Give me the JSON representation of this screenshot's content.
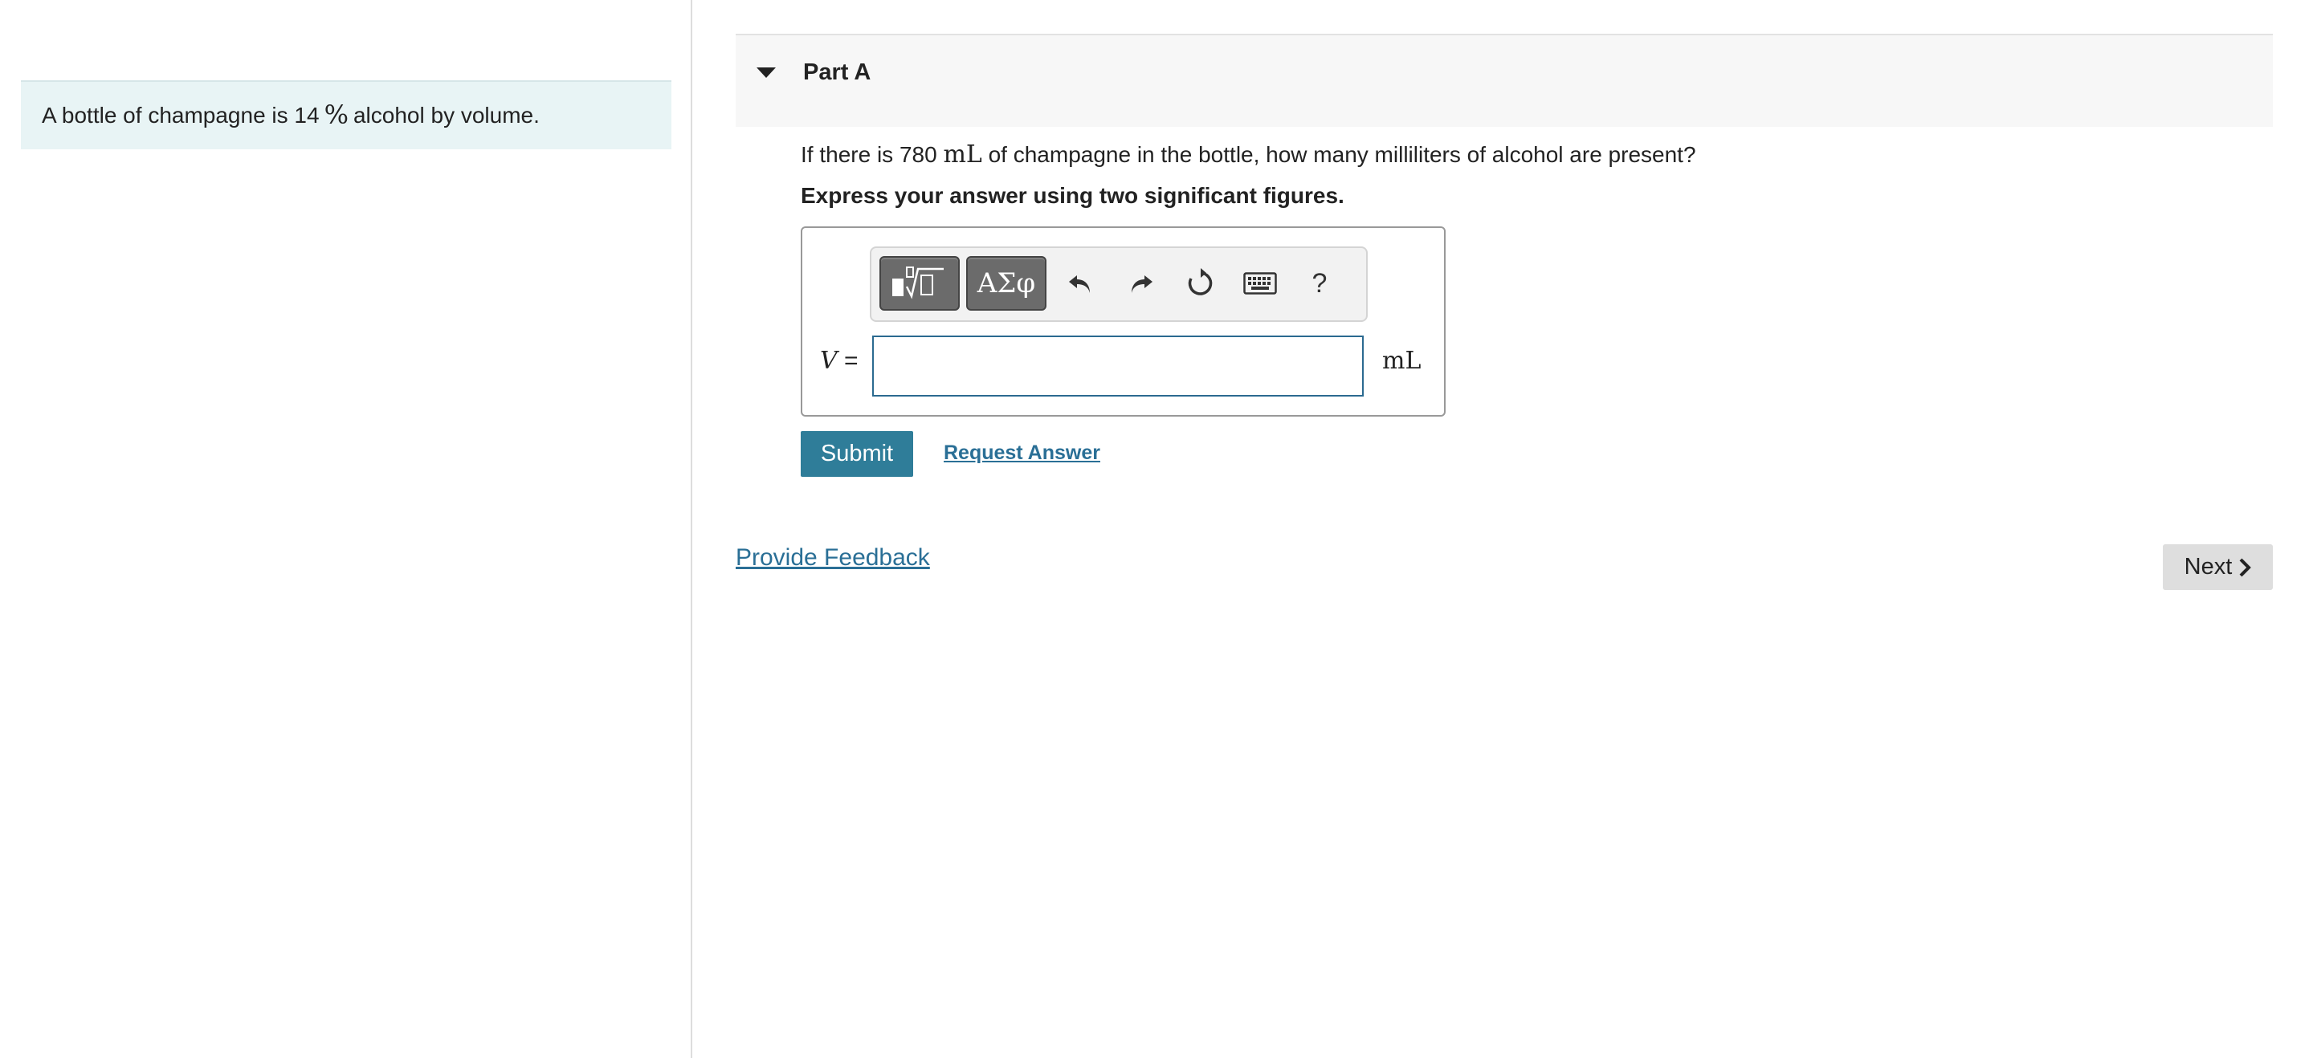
{
  "problem": {
    "text_before": "A bottle of champagne is 14",
    "percent_symbol": "%",
    "text_after": "alcohol by volume."
  },
  "part": {
    "title": "Part A",
    "question_before": "If there is 780",
    "question_unit": "mL",
    "question_after": "of champagne in the bottle, how many milliliters of alcohol are present?",
    "instruction": "Express your answer using two significant figures."
  },
  "toolbar": {
    "symbols_label": "ΑΣφ",
    "help_label": "?"
  },
  "answer": {
    "variable": "V",
    "equals": "=",
    "value": "",
    "unit": "mL"
  },
  "actions": {
    "submit_label": "Submit",
    "request_answer_label": "Request Answer",
    "provide_feedback_label": "Provide Feedback",
    "next_label": "Next"
  },
  "colors": {
    "problem_bg": "#e8f4f5",
    "submit_bg": "#2f7d99",
    "link": "#2a6f96",
    "toolbar_button": "#6b6b6b"
  }
}
